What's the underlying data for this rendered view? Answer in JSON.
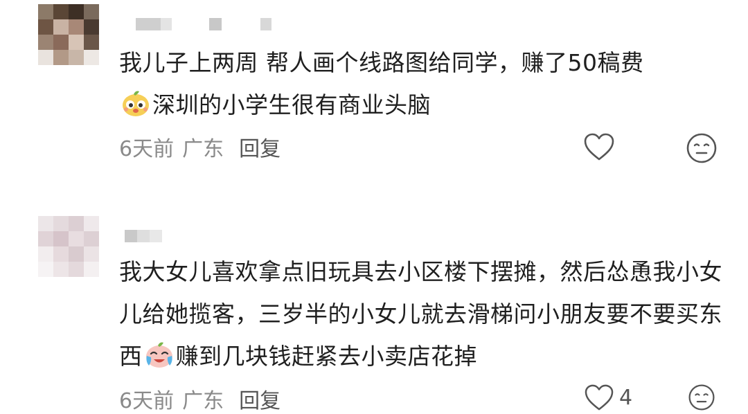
{
  "comments": [
    {
      "text_a": "我儿子上两周 帮人画个线路图给同学，赚了50稿费",
      "emoji_a": "cute-face-emoji",
      "text_b": "深圳的小学生很有商业头脑",
      "time": "6天前",
      "location": "广东",
      "reply_label": "回复",
      "like_icon": "heart-outline-icon",
      "like_count": "",
      "reaction_icon": "neutral-face-icon"
    },
    {
      "text_a": "我大女儿喜欢拿点旧玩具去小区楼下摆摊，然后怂恿我小女儿给她揽客，三岁半的小女儿就去滑梯问小朋友要不要买东西",
      "emoji_a": "crying-laughing-face-emoji",
      "text_b": "赚到几块钱赶紧去小卖店花掉",
      "time": "6天前",
      "location": "广东",
      "reply_label": "回复",
      "like_icon": "heart-outline-icon",
      "like_count": "4",
      "reaction_icon": "neutral-face-icon"
    }
  ],
  "colors": {
    "text": "#1f1f1f",
    "meta": "#8a8a8a",
    "icon": "#555555"
  }
}
